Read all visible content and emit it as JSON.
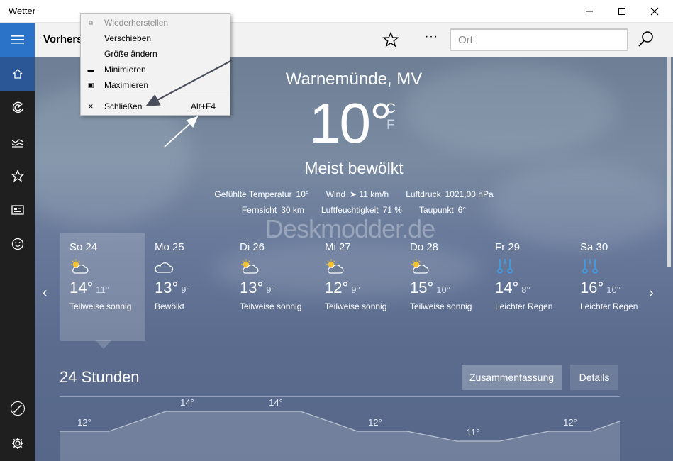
{
  "window": {
    "title": "Wetter",
    "minimize_label": "—",
    "maximize_label": "☐",
    "close_label": "✕"
  },
  "rail": {
    "items": [
      "menu",
      "home",
      "forecast-maps",
      "historical-weather",
      "favorites",
      "news",
      "feedback",
      "colormodder",
      "settings"
    ]
  },
  "header": {
    "title": "Vorhers",
    "more_label": "···",
    "search_placeholder": "Ort"
  },
  "current": {
    "location": "Warnemünde, MV",
    "temperature": "10°",
    "unit_c": "C",
    "unit_f": "F",
    "condition": "Meist bewölkt",
    "details_row1": [
      {
        "label": "Gefühlte Temperatur",
        "value": "10°"
      },
      {
        "label": "Wind",
        "value": "➤ 11 km/h"
      },
      {
        "label": "Luftdruck",
        "value": "1021,00 hPa"
      }
    ],
    "details_row2": [
      {
        "label": "Fernsicht",
        "value": "30 km"
      },
      {
        "label": "Luftfeuchtigkeit",
        "value": "71 %"
      },
      {
        "label": "Taupunkt",
        "value": "6°"
      }
    ]
  },
  "watermark": "Deskmodder.de",
  "forecast": {
    "days": [
      {
        "date": "So 24",
        "high": "14°",
        "low": "11°",
        "desc": "Teilweise sonnig",
        "icon": "partly-sunny"
      },
      {
        "date": "Mo 25",
        "high": "13°",
        "low": "9°",
        "desc": "Bewölkt",
        "icon": "cloudy"
      },
      {
        "date": "Di 26",
        "high": "13°",
        "low": "9°",
        "desc": "Teilweise sonnig",
        "icon": "partly-sunny"
      },
      {
        "date": "Mi 27",
        "high": "12°",
        "low": "9°",
        "desc": "Teilweise sonnig",
        "icon": "partly-sunny"
      },
      {
        "date": "Do 28",
        "high": "15°",
        "low": "10°",
        "desc": "Teilweise sonnig",
        "icon": "partly-sunny"
      },
      {
        "date": "Fr 29",
        "high": "14°",
        "low": "8°",
        "desc": "Leichter Regen",
        "icon": "light-rain"
      },
      {
        "date": "Sa 30",
        "high": "16°",
        "low": "10°",
        "desc": "Leichter Regen",
        "icon": "light-rain"
      }
    ],
    "prev_label": "‹",
    "next_label": "›"
  },
  "hourly": {
    "title": "24 Stunden",
    "summary_label": "Zusammenfassung",
    "details_label": "Details",
    "temps": [
      "12°",
      "14°",
      "14°",
      "12°",
      "11°",
      "12°"
    ]
  },
  "context_menu": {
    "items": [
      {
        "label": "Wiederherstellen",
        "shortcut": "",
        "icon": "restore-icon",
        "disabled": true
      },
      {
        "label": "Verschieben",
        "shortcut": "",
        "icon": "",
        "disabled": false
      },
      {
        "label": "Größe ändern",
        "shortcut": "",
        "icon": "",
        "disabled": false
      },
      {
        "label": "Minimieren",
        "shortcut": "",
        "icon": "minimize-icon",
        "disabled": false
      },
      {
        "label": "Maximieren",
        "shortcut": "",
        "icon": "maximize-icon",
        "disabled": false
      },
      {
        "label": "Schließen",
        "shortcut": "Alt+F4",
        "icon": "close-icon",
        "disabled": false
      }
    ]
  },
  "colors": {
    "rail_bg": "#1f1f1f",
    "rail_accent": "#2b73c8",
    "rail_active": "#2b5797",
    "rain_icon": "#3fa0e8",
    "arrow": "#4a4f5c"
  }
}
